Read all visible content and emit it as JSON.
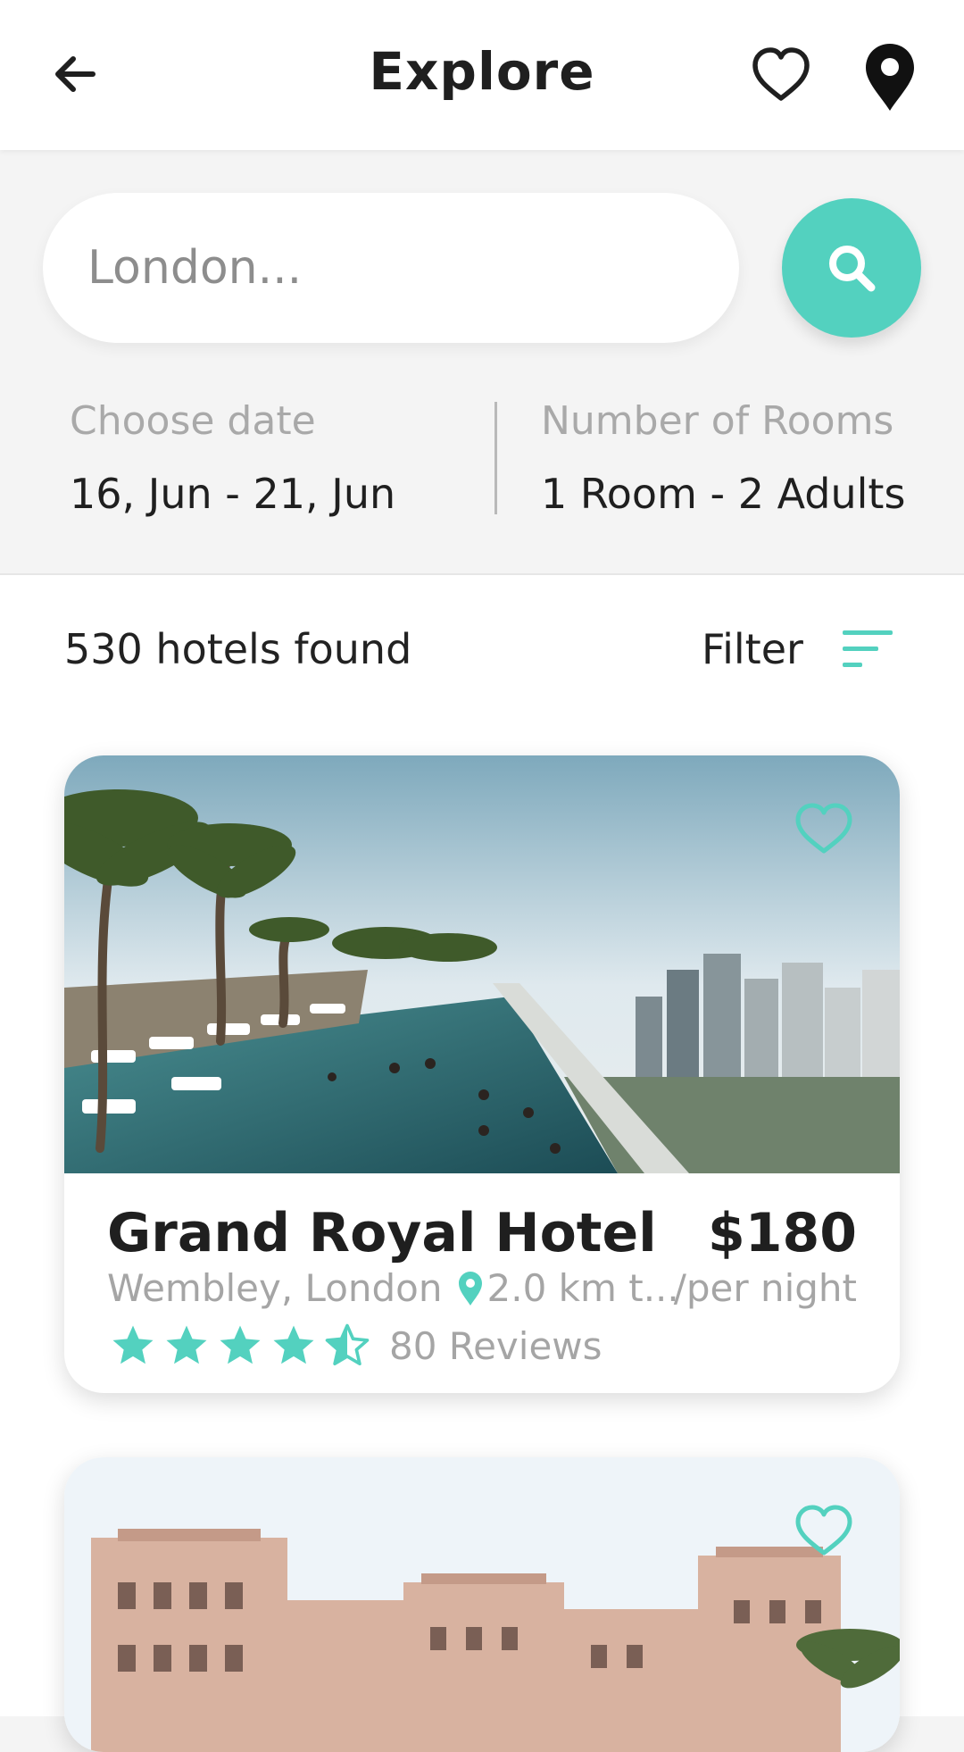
{
  "header": {
    "title": "Explore",
    "back_icon": "arrow-left-icon",
    "favorite_icon": "heart-outline-icon",
    "map_icon": "map-pin-icon"
  },
  "search": {
    "placeholder": "London...",
    "button_icon": "search-icon"
  },
  "date": {
    "label": "Choose date",
    "value": "16, Jun - 21, Jun"
  },
  "rooms": {
    "label": "Number of Rooms",
    "value": "1 Room - 2 Adults"
  },
  "results": {
    "count_text": "530 hotels found",
    "filter_label": "Filter",
    "filter_icon": "sort-lines-icon"
  },
  "hotels": [
    {
      "name": "Grand Royal Hotel",
      "price": "$180",
      "location": "Wembley, London",
      "distance": "2.0 km t...",
      "per_night": "/per night",
      "rating": 4.5,
      "reviews": "80 Reviews"
    },
    {
      "name": "",
      "price": "",
      "location": "",
      "distance": "",
      "per_night": "",
      "rating": null,
      "reviews": ""
    }
  ],
  "colors": {
    "accent": "#53d1bf",
    "background": "#f4f4f4",
    "text_primary": "#1f1f1f",
    "text_secondary": "#a5a5a5"
  }
}
